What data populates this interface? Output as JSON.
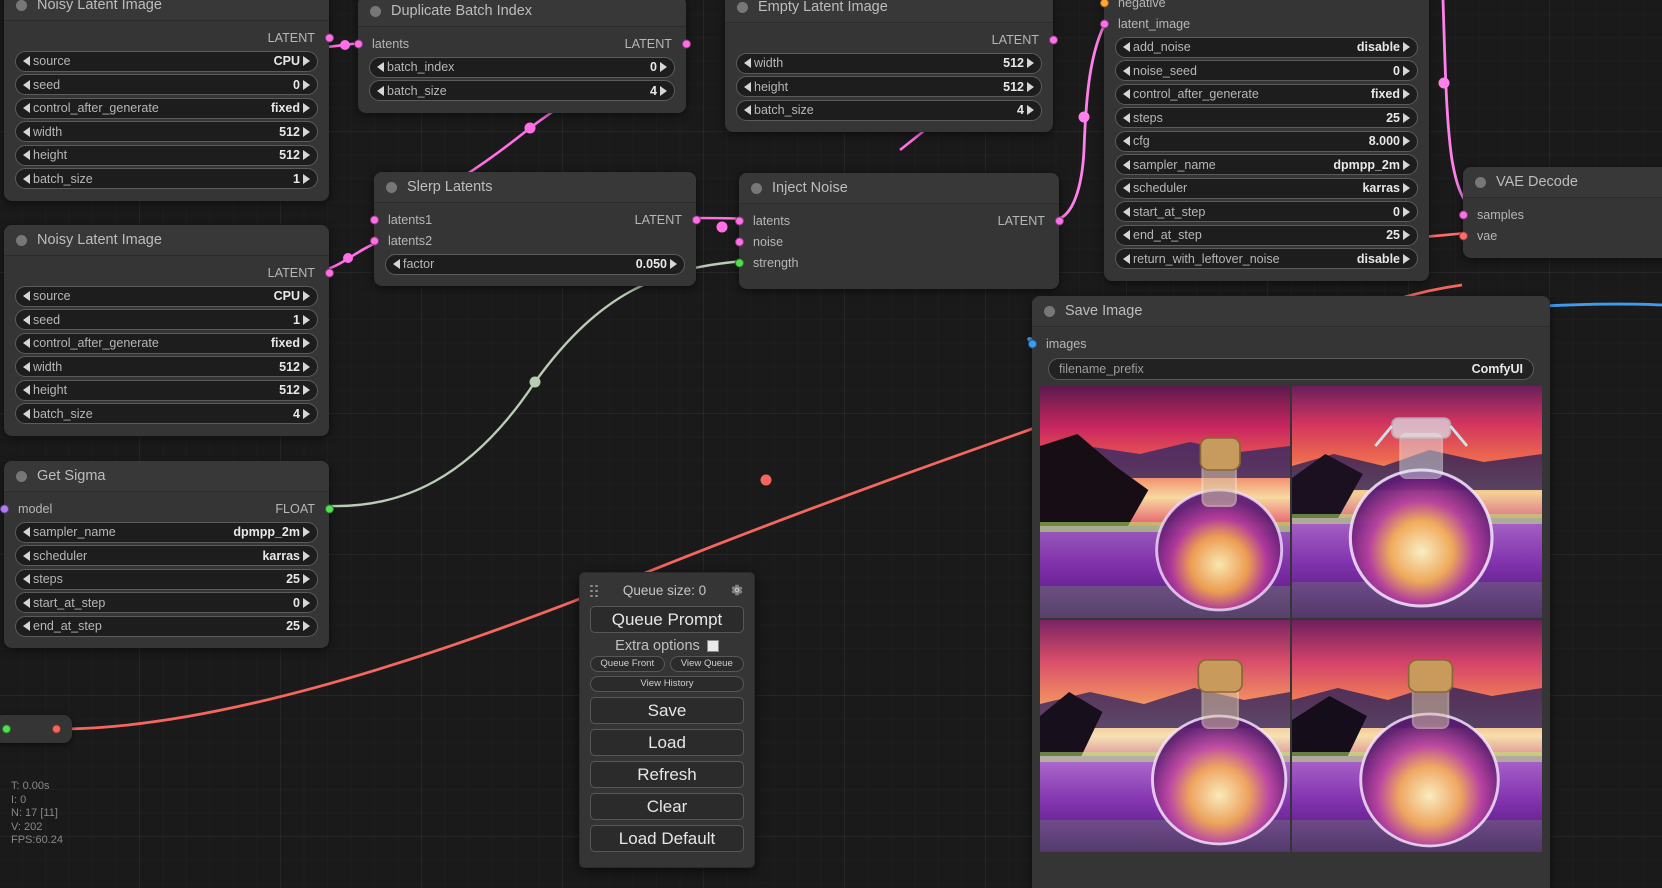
{
  "app": {
    "name": "ComfyUI",
    "background": "#1a1a1a",
    "node_bg": "#353535"
  },
  "colors": {
    "latent": "#ff6fe6",
    "float": "#50e050",
    "model": "#b27cf5",
    "image": "#3f9bf0",
    "vae": "#ff6c6c",
    "conditioning": "#ffa633"
  },
  "nodes": {
    "noisy_latent_1": {
      "title": "Noisy Latent Image",
      "output_label": "LATENT",
      "widgets": [
        {
          "name": "source",
          "value": "CPU"
        },
        {
          "name": "seed",
          "value": "0"
        },
        {
          "name": "control_after_generate",
          "value": "fixed"
        },
        {
          "name": "width",
          "value": "512"
        },
        {
          "name": "height",
          "value": "512"
        },
        {
          "name": "batch_size",
          "value": "1"
        }
      ]
    },
    "noisy_latent_2": {
      "title": "Noisy Latent Image",
      "output_label": "LATENT",
      "widgets": [
        {
          "name": "source",
          "value": "CPU"
        },
        {
          "name": "seed",
          "value": "1"
        },
        {
          "name": "control_after_generate",
          "value": "fixed"
        },
        {
          "name": "width",
          "value": "512"
        },
        {
          "name": "height",
          "value": "512"
        },
        {
          "name": "batch_size",
          "value": "4"
        }
      ]
    },
    "get_sigma": {
      "title": "Get Sigma",
      "input_label": "model",
      "output_label": "FLOAT",
      "widgets": [
        {
          "name": "sampler_name",
          "value": "dpmpp_2m"
        },
        {
          "name": "scheduler",
          "value": "karras"
        },
        {
          "name": "steps",
          "value": "25"
        },
        {
          "name": "start_at_step",
          "value": "0"
        },
        {
          "name": "end_at_step",
          "value": "25"
        }
      ]
    },
    "duplicate_batch_index": {
      "title": "Duplicate Batch Index",
      "input_label": "latents",
      "output_label": "LATENT",
      "widgets": [
        {
          "name": "batch_index",
          "value": "0"
        },
        {
          "name": "batch_size",
          "value": "4"
        }
      ]
    },
    "empty_latent_image": {
      "title": "Empty Latent Image",
      "output_label": "LATENT",
      "widgets": [
        {
          "name": "width",
          "value": "512"
        },
        {
          "name": "height",
          "value": "512"
        },
        {
          "name": "batch_size",
          "value": "4"
        }
      ]
    },
    "slerp_latents": {
      "title": "Slerp Latents",
      "inputs": [
        "latents1",
        "latents2"
      ],
      "output_label": "LATENT",
      "widgets": [
        {
          "name": "factor",
          "value": "0.050"
        }
      ]
    },
    "inject_noise": {
      "title": "Inject Noise",
      "inputs": [
        "latents",
        "noise",
        "strength"
      ],
      "output_label": "LATENT"
    },
    "ksampler_advanced": {
      "inputs": [
        "negative",
        "latent_image"
      ],
      "widgets": [
        {
          "name": "add_noise",
          "value": "disable"
        },
        {
          "name": "noise_seed",
          "value": "0"
        },
        {
          "name": "control_after_generate",
          "value": "fixed"
        },
        {
          "name": "steps",
          "value": "25"
        },
        {
          "name": "cfg",
          "value": "8.000"
        },
        {
          "name": "sampler_name",
          "value": "dpmpp_2m"
        },
        {
          "name": "scheduler",
          "value": "karras"
        },
        {
          "name": "start_at_step",
          "value": "0"
        },
        {
          "name": "end_at_step",
          "value": "25"
        },
        {
          "name": "return_with_leftover_noise",
          "value": "disable"
        }
      ]
    },
    "vae_decode": {
      "title": "VAE Decode",
      "inputs": [
        "samples",
        "vae"
      ]
    },
    "save_image": {
      "title": "Save Image",
      "input_label": "images",
      "widget": {
        "name": "filename_prefix",
        "value": "ComfyUI"
      },
      "thumbnails": [
        "lavender-field-sunset-bottle-1",
        "lavender-field-sunset-bottle-2",
        "lavender-field-sunset-bottle-3",
        "lavender-field-sunset-bottle-4"
      ]
    }
  },
  "menu": {
    "queue_size_label": "Queue size: 0",
    "gear_icon": "gear-icon",
    "queue_prompt": "Queue Prompt",
    "extra_options": "Extra options",
    "queue_front": "Queue Front",
    "view_queue": "View Queue",
    "view_history": "View History",
    "save": "Save",
    "load": "Load",
    "refresh": "Refresh",
    "clear": "Clear",
    "load_default": "Load Default"
  },
  "stats": {
    "time": "T: 0.00s",
    "iterations": "I: 0",
    "nodes": "N: 17 [11]",
    "vertices": "V: 202",
    "fps": "FPS:60.24"
  }
}
